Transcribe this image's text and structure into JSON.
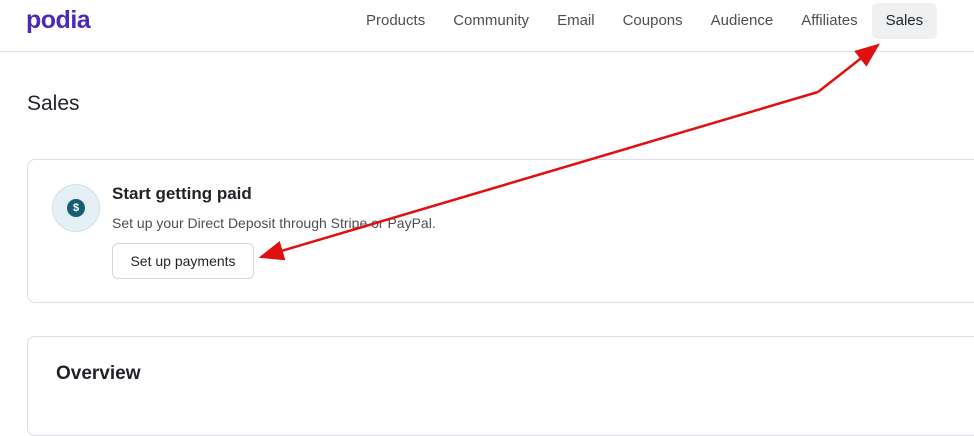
{
  "app": {
    "logo": "podia"
  },
  "nav": {
    "items": [
      {
        "label": "Products"
      },
      {
        "label": "Community"
      },
      {
        "label": "Email"
      },
      {
        "label": "Coupons"
      },
      {
        "label": "Audience"
      },
      {
        "label": "Affiliates"
      },
      {
        "label": "Sales",
        "active": true
      }
    ]
  },
  "page": {
    "title": "Sales"
  },
  "payout_card": {
    "icon": "dollar-coin-icon",
    "title": "Start getting paid",
    "description": "Set up your Direct Deposit through Stripe or PayPal.",
    "button_label": "Set up payments",
    "coin_symbol": "$"
  },
  "overview_card": {
    "title": "Overview"
  },
  "colors": {
    "brand": "#4b2bb3",
    "annotation_arrow": "#e01010",
    "icon_bg": "#155e75"
  }
}
